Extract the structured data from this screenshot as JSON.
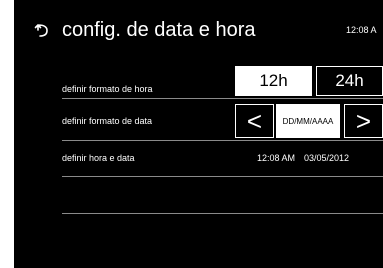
{
  "header": {
    "title": "config. de data e hora",
    "clock": "12:08 A"
  },
  "rows": {
    "time_format": {
      "label": "definir formato de hora",
      "option_12h": "12h",
      "option_24h": "24h",
      "selected": "12h"
    },
    "date_format": {
      "label": "definir formato de data",
      "prev_glyph": "<",
      "value": "DD/MM/AAAA",
      "next_glyph": ">"
    },
    "date_time": {
      "label": "definir hora e data",
      "time_value": "12:08 AM",
      "date_value": "03/05/2012"
    }
  },
  "icons": {
    "back": "back-arrow-icon"
  },
  "colors": {
    "background": "#000000",
    "text": "#ffffff",
    "selected_bg": "#ffffff",
    "divider": "#8a8a8a"
  }
}
